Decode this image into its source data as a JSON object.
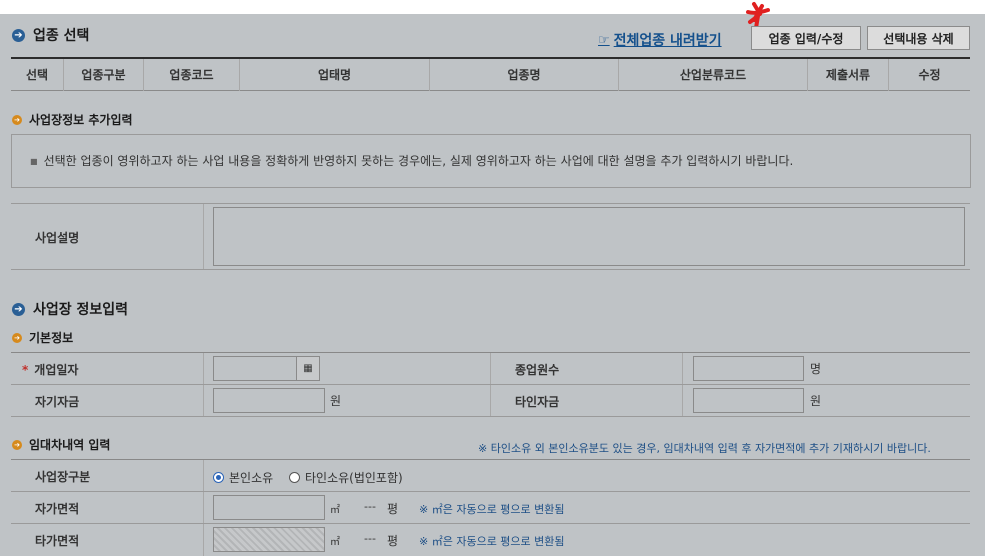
{
  "section1": {
    "title": "업종 선택",
    "download_link": "전체업종 내려받기",
    "btn_input": "업종 입력/수정",
    "btn_delete": "선택내용 삭제",
    "columns": [
      "선택",
      "업종구분",
      "업종코드",
      "업태명",
      "업종명",
      "산업분류코드",
      "제출서류",
      "수정"
    ]
  },
  "extra": {
    "title": "사업장정보 추가입력",
    "notice": "선택한 업종이 영위하고자 하는 사업 내용을 정확하게 반영하지 못하는 경우에는, 실제 영위하고자 하는 사업에 대한 설명을 추가 입력하시기 바랍니다.",
    "desc_label": "사업설명",
    "desc_value": ""
  },
  "section2": {
    "title": "사업장 정보입력",
    "basic_title": "기본정보",
    "open_date_label": "개업일자",
    "required_mark": "*",
    "open_date_value": "",
    "employees_label": "종업원수",
    "employees_value": "",
    "employees_unit": "명",
    "own_capital_label": "자기자금",
    "own_capital_value": "",
    "own_capital_unit": "원",
    "other_capital_label": "타인자금",
    "other_capital_value": "",
    "other_capital_unit": "원"
  },
  "lease": {
    "title": "임대차내역 입력",
    "note": "※ 타인소유 외 본인소유분도 있는 경우, 임대차내역 입력 후 자가면적에 추가 기재하시기 바랍니다.",
    "type_label": "사업장구분",
    "option_own": "본인소유",
    "option_other": "타인소유(법인포함)",
    "selected": "본인소유",
    "own_area_label": "자가면적",
    "other_area_label": "타가면적",
    "area_unit": "㎡",
    "pyeong_value": "---",
    "pyeong_unit": "평",
    "convert_note": "※ ㎡은 자동으로 평으로 변환됨"
  },
  "colors": {
    "accent_blue": "#2a5f95",
    "orange": "#d68a1d",
    "note_blue": "#1e4f86",
    "required_red": "#c0302b"
  }
}
